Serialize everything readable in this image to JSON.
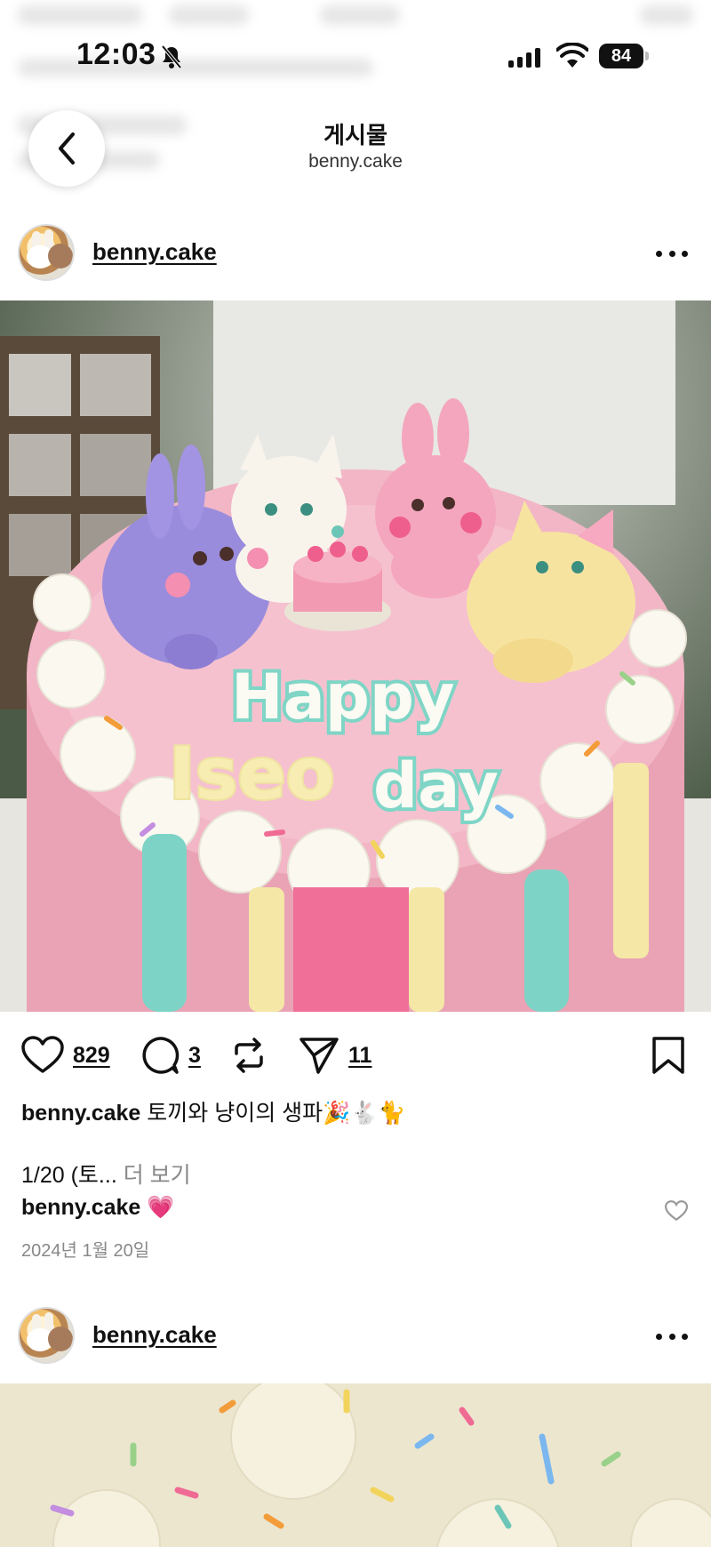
{
  "status_bar": {
    "time": "12:03",
    "battery": "84"
  },
  "header": {
    "title": "게시물",
    "subtitle": "benny.cake"
  },
  "posts": [
    {
      "username": "benny.cake",
      "photo_description": "pink cake with bunny and cat figurines, Happy Iseo Day",
      "likes": "829",
      "comments": "3",
      "shares": "11",
      "caption_user": "benny.cake",
      "caption_text": "토끼와 냥이의 생파🎉🐇🐈",
      "caption_more_prefix": "1/20 (토...",
      "caption_more_link": "더 보기",
      "comment_user": "benny.cake",
      "comment_text": "💗",
      "date": "2024년 1월 20일"
    },
    {
      "username": "benny.cake"
    }
  ],
  "colors": {
    "text": "#111111",
    "muted": "#888888"
  }
}
